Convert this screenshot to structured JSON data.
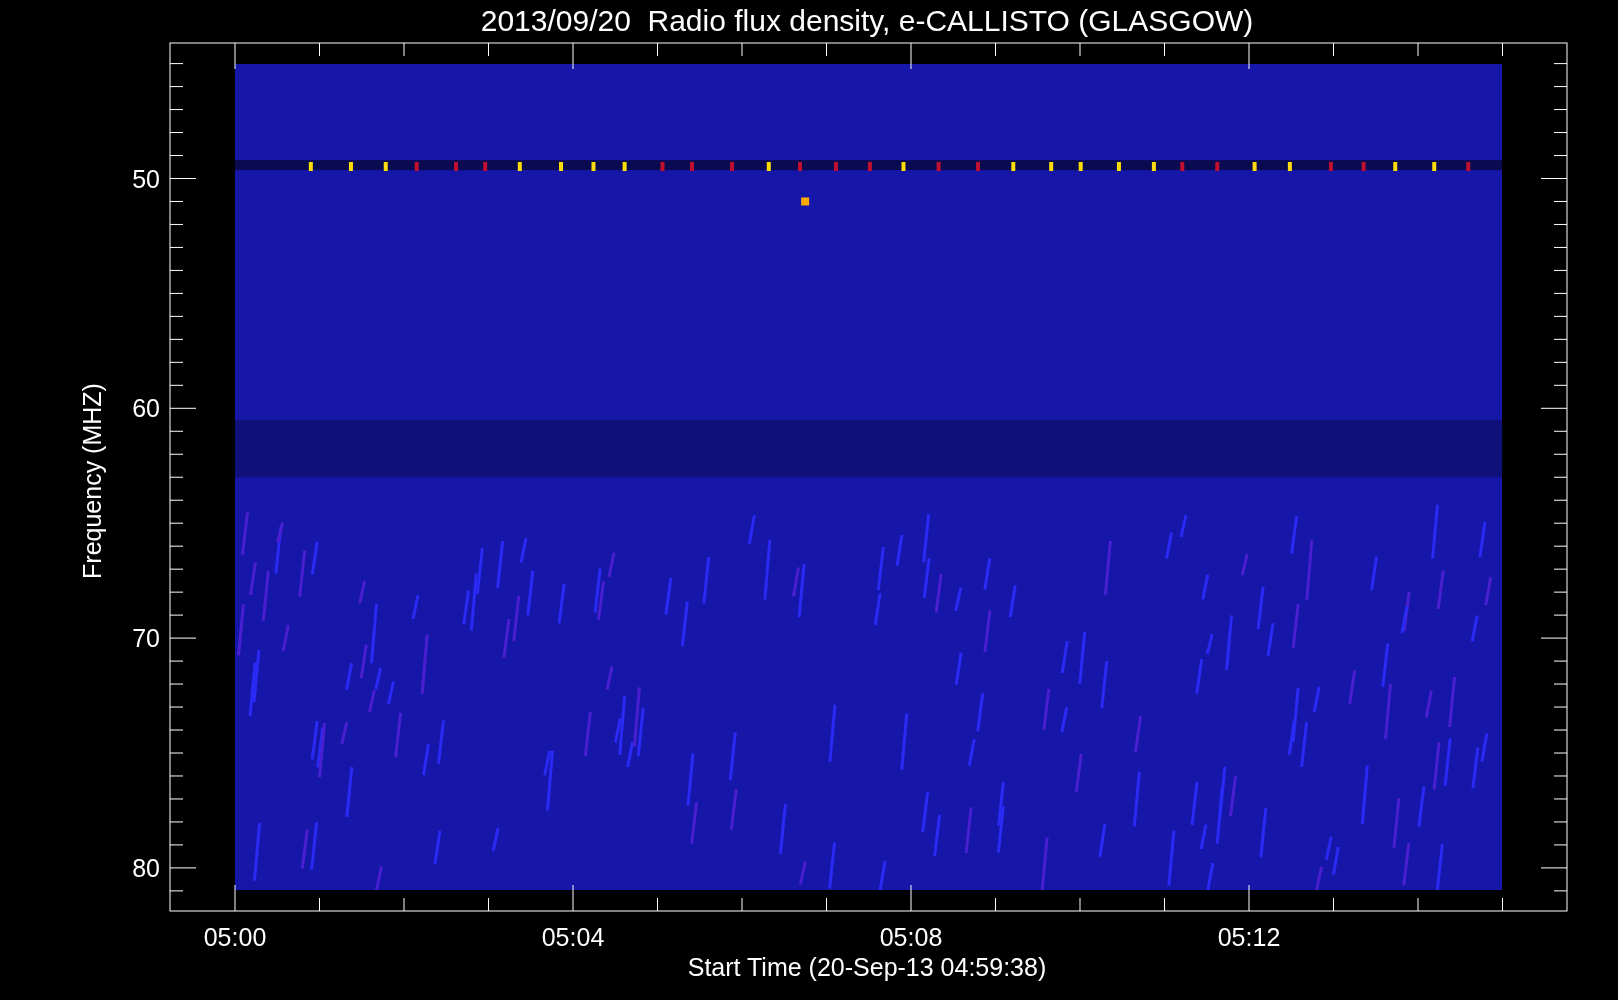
{
  "title": "2013/09/20  Radio flux density, e-CALLISTO (GLASGOW)",
  "ylabel": "Frequency (MHZ)",
  "xlabel": "Start Time (20-Sep-13 04:59:38)",
  "yticks": [
    "50",
    "60",
    "70",
    "80"
  ],
  "xticks": [
    "05:00",
    "05:04",
    "05:08",
    "05:12"
  ]
}
